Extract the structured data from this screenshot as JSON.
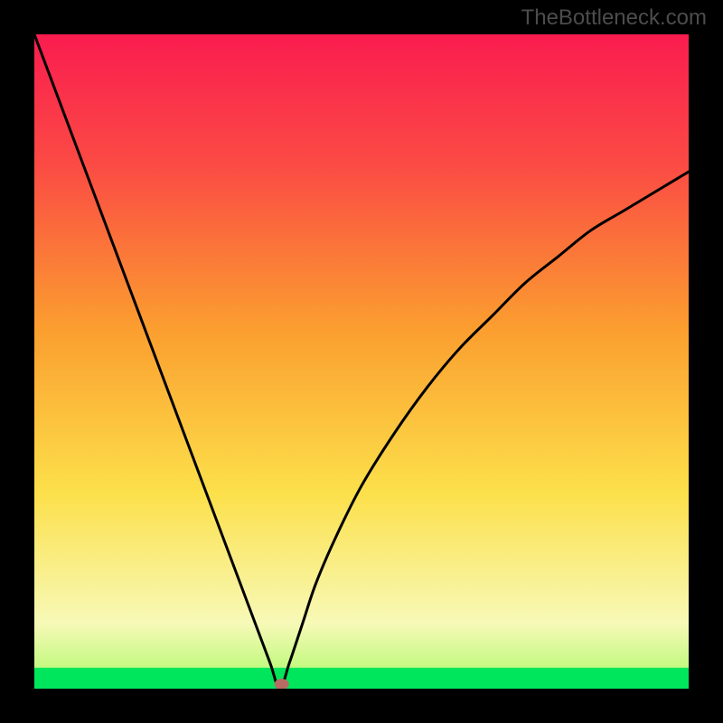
{
  "watermark": "TheBottleneck.com",
  "chart_data": {
    "type": "line",
    "title": "",
    "xlabel": "",
    "ylabel": "",
    "xlim": [
      0,
      100
    ],
    "ylim": [
      0,
      100
    ],
    "series": [
      {
        "name": "bottleneck-curve",
        "x": [
          0,
          3,
          6,
          9,
          12,
          15,
          18,
          21,
          24,
          27,
          30,
          33,
          36,
          37.5,
          39,
          41,
          43,
          46,
          50,
          55,
          60,
          65,
          70,
          75,
          80,
          85,
          90,
          95,
          100
        ],
        "y": [
          100,
          92,
          84,
          76,
          68,
          60,
          52,
          44,
          36,
          28,
          20,
          12,
          4,
          0,
          4,
          10,
          16,
          23,
          31,
          39,
          46,
          52,
          57,
          62,
          66,
          70,
          73,
          76,
          79
        ]
      }
    ],
    "marker": {
      "x_percent": 37.8,
      "y_percent": 0
    },
    "green_band": {
      "y_start_percent": 0,
      "y_end_percent": 3.2,
      "color": "#00e65c"
    },
    "gradient_stops": [
      {
        "pct": 0,
        "color": "#00e65c"
      },
      {
        "pct": 3,
        "color": "#c2f97f"
      },
      {
        "pct": 10,
        "color": "#f7f9b7"
      },
      {
        "pct": 30,
        "color": "#fce04a"
      },
      {
        "pct": 55,
        "color": "#fb9e2f"
      },
      {
        "pct": 80,
        "color": "#fb4b44"
      },
      {
        "pct": 100,
        "color": "#fa1c4f"
      }
    ]
  }
}
